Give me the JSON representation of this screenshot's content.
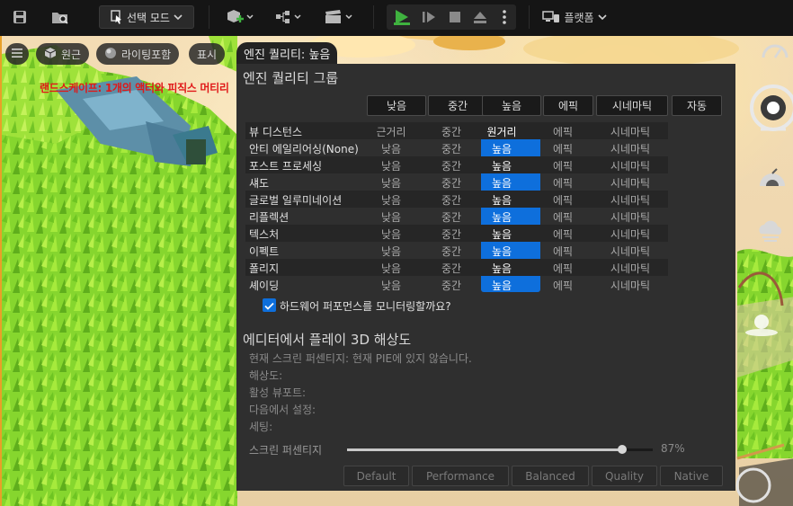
{
  "toolbar": {
    "mode_label": "선택 모드",
    "platform_label": "플랫폼"
  },
  "viewport": {
    "pills": [
      "원근",
      "라이팅포함",
      "표시"
    ],
    "engine_quality_pill": "엔진 퀄리티: 높음",
    "warning_text": "랜드스케이프: 1개의 액터와 피직스 머티리"
  },
  "quality": {
    "title": "엔진 퀄리티 그룹",
    "headers": [
      "낮음",
      "중간",
      "높음",
      "에픽",
      "시네마틱",
      "자동"
    ],
    "rows": [
      {
        "label": "뷰 디스턴스",
        "options": [
          "근거리",
          "중간",
          "원거리",
          "에픽",
          "시네마틱"
        ]
      },
      {
        "label": "안티 에일리어싱(None)",
        "options": [
          "낮음",
          "중간",
          "높음",
          "에픽",
          "시네마틱"
        ]
      },
      {
        "label": "포스트 프로세싱",
        "options": [
          "낮음",
          "중간",
          "높음",
          "에픽",
          "시네마틱"
        ]
      },
      {
        "label": "섀도",
        "options": [
          "낮음",
          "중간",
          "높음",
          "에픽",
          "시네마틱"
        ]
      },
      {
        "label": "글로벌 일루미네이션",
        "options": [
          "낮음",
          "중간",
          "높음",
          "에픽",
          "시네마틱"
        ]
      },
      {
        "label": "리플렉션",
        "options": [
          "낮음",
          "중간",
          "높음",
          "에픽",
          "시네마틱"
        ]
      },
      {
        "label": "텍스처",
        "options": [
          "낮음",
          "중간",
          "높음",
          "에픽",
          "시네마틱"
        ]
      },
      {
        "label": "이펙트",
        "options": [
          "낮음",
          "중간",
          "높음",
          "에픽",
          "시네마틱"
        ]
      },
      {
        "label": "폴리지",
        "options": [
          "낮음",
          "중간",
          "높음",
          "에픽",
          "시네마틱"
        ]
      },
      {
        "label": "셰이딩",
        "options": [
          "낮음",
          "중간",
          "높음",
          "에픽",
          "시네마틱"
        ]
      }
    ],
    "selected_index": 2,
    "monitor_label": "하드웨어 퍼포먼스를 모니터링할까요?",
    "monitor_checked": true
  },
  "pie": {
    "title": "에디터에서 플레이 3D 해상도",
    "lines": [
      "현재 스크린 퍼센티지: 현재 PIE에 있지 않습니다.",
      "해상도:",
      "활성 뷰포트:",
      "다음에서 설정:",
      "세팅:"
    ],
    "screen_percentage_label": "스크린 퍼센티지",
    "screen_percentage_value": 87,
    "screen_percentage_text": "87%",
    "presets": [
      "Default",
      "Performance",
      "Balanced",
      "Quality",
      "Native"
    ]
  },
  "colors": {
    "accent": "#0e6fdc",
    "play_green": "#3fb23f",
    "warning_red": "#e01818",
    "grass": "#7ed12a"
  }
}
